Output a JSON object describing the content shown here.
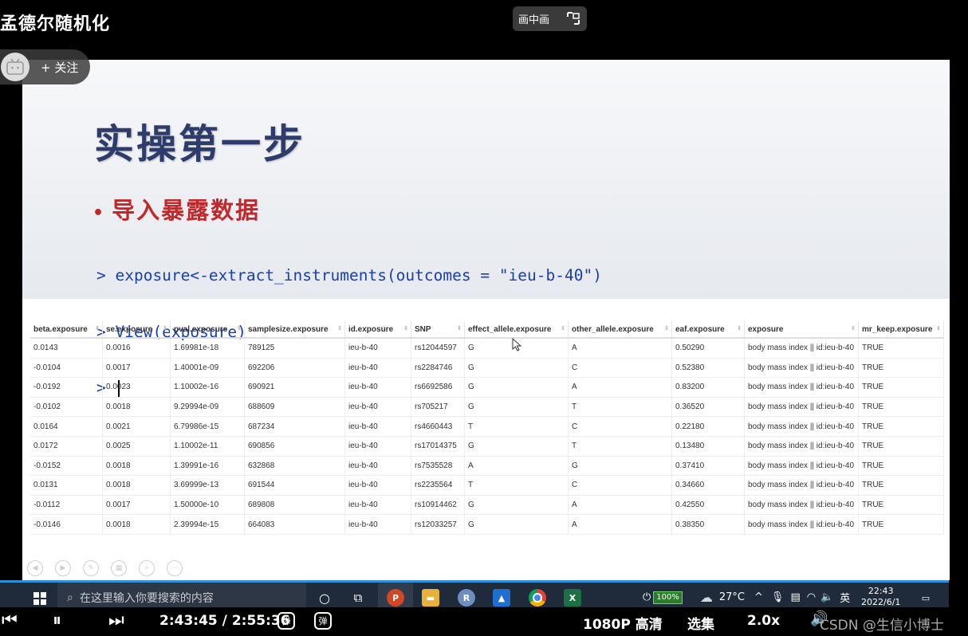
{
  "video": {
    "title": "孟德尔随机化",
    "pip_label": "画中画",
    "follow_label": "+ 关注"
  },
  "slide": {
    "title": "实操第一步",
    "bullet": "导入暴露数据",
    "code_lines": [
      "> exposure<-extract_instruments(outcomes = \"ieu-b-40\")",
      "> View(exposure)",
      "> "
    ]
  },
  "table": {
    "columns": [
      "beta.exposure",
      "se.exposure",
      "pval.exposure",
      "samplesize.exposure",
      "id.exposure",
      "SNP",
      "effect_allele.exposure",
      "other_allele.exposure",
      "eaf.exposure",
      "exposure",
      "mr_keep.exposure"
    ],
    "rows": [
      [
        "0.0143",
        "0.0016",
        "1.69981e-18",
        "789125",
        "ieu-b-40",
        "rs12044597",
        "G",
        "A",
        "0.50290",
        "body mass index || id:ieu-b-40",
        "TRUE"
      ],
      [
        "-0.0104",
        "0.0017",
        "1.40001e-09",
        "692206",
        "ieu-b-40",
        "rs2284746",
        "G",
        "C",
        "0.52380",
        "body mass index || id:ieu-b-40",
        "TRUE"
      ],
      [
        "-0.0192",
        "0.0023",
        "1.10002e-16",
        "690921",
        "ieu-b-40",
        "rs6692586",
        "G",
        "A",
        "0.83200",
        "body mass index || id:ieu-b-40",
        "TRUE"
      ],
      [
        "-0.0102",
        "0.0018",
        "9.29994e-09",
        "688609",
        "ieu-b-40",
        "rs705217",
        "G",
        "T",
        "0.36520",
        "body mass index || id:ieu-b-40",
        "TRUE"
      ],
      [
        "0.0164",
        "0.0021",
        "6.79986e-15",
        "687234",
        "ieu-b-40",
        "rs4660443",
        "T",
        "C",
        "0.22180",
        "body mass index || id:ieu-b-40",
        "TRUE"
      ],
      [
        "0.0172",
        "0.0025",
        "1.10002e-11",
        "690856",
        "ieu-b-40",
        "rs17014375",
        "G",
        "T",
        "0.13480",
        "body mass index || id:ieu-b-40",
        "TRUE"
      ],
      [
        "-0.0152",
        "0.0018",
        "1.39991e-16",
        "632868",
        "ieu-b-40",
        "rs7535528",
        "A",
        "G",
        "0.37410",
        "body mass index || id:ieu-b-40",
        "TRUE"
      ],
      [
        "0.0131",
        "0.0018",
        "3.69999e-13",
        "691544",
        "ieu-b-40",
        "rs2235564",
        "T",
        "C",
        "0.34660",
        "body mass index || id:ieu-b-40",
        "TRUE"
      ],
      [
        "-0.0112",
        "0.0017",
        "1.50000e-10",
        "689808",
        "ieu-b-40",
        "rs10914462",
        "G",
        "A",
        "0.42550",
        "body mass index || id:ieu-b-40",
        "TRUE"
      ],
      [
        "-0.0146",
        "0.0018",
        "2.39994e-15",
        "664083",
        "ieu-b-40",
        "rs12033257",
        "G",
        "A",
        "0.38350",
        "body mass index || id:ieu-b-40",
        "TRUE"
      ]
    ]
  },
  "taskbar": {
    "search_placeholder": "在这里输入你要搜索的内容",
    "battery": "100%",
    "weather": "27°C",
    "ime": "英",
    "time": "22:43",
    "date": "2022/6/1",
    "apps": [
      "powerpoint-icon",
      "file-explorer-icon",
      "r-icon",
      "sketch-app-icon",
      "chrome-icon",
      "excel-icon"
    ]
  },
  "player": {
    "current_time": "2:43:45",
    "separator": "/",
    "duration": "2:55:36",
    "danmu_label": "弹",
    "quality": "1080P 高清",
    "episodes": "选集",
    "speed": "2.0x",
    "watermark": "CSDN @生信小博士"
  },
  "colors": {
    "title_color": "#2e3c6b",
    "bullet_color": "#c0282b",
    "code_color": "#1a3fb0",
    "taskbar_bg": "#1f2b3a"
  }
}
